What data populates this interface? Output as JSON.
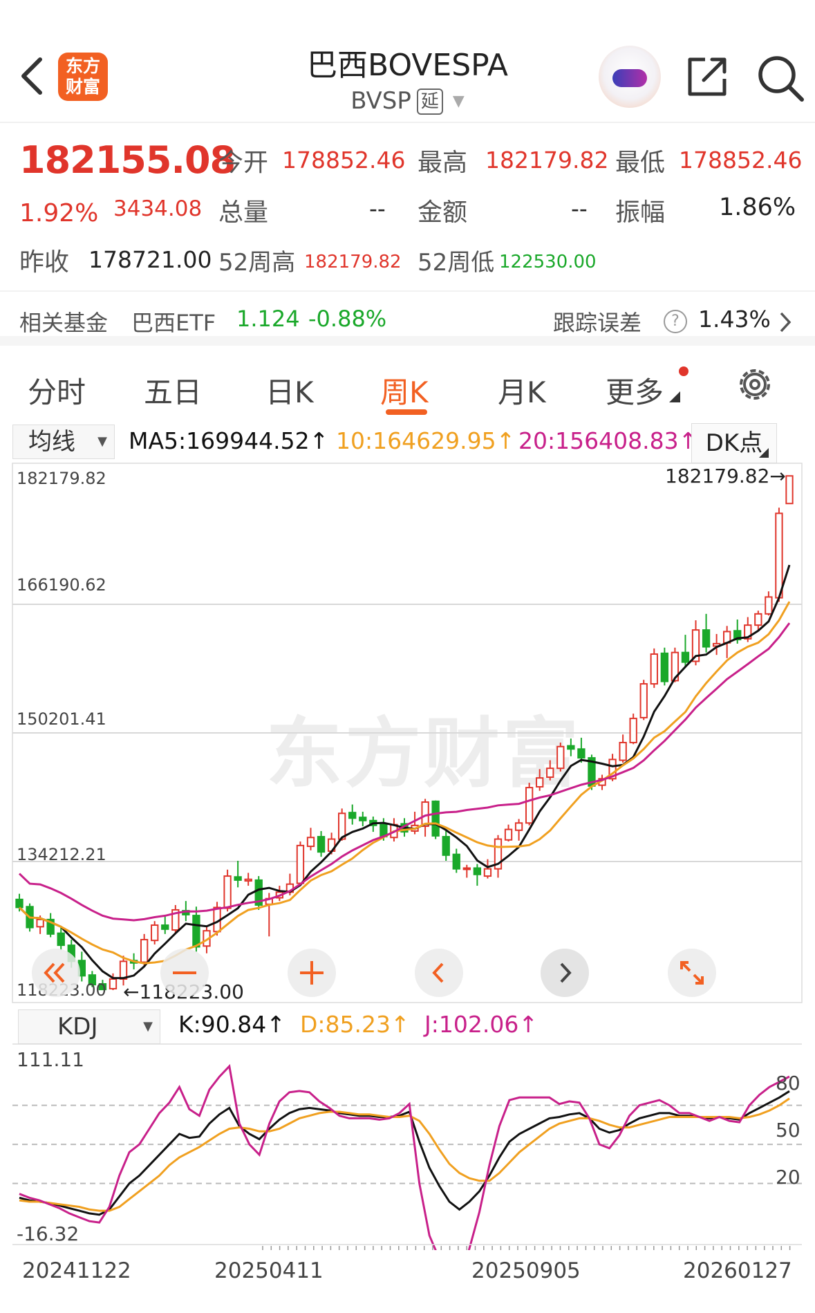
{
  "header": {
    "app_logo_line1": "东方",
    "app_logo_line2": "财富",
    "title": "巴西BOVESPA",
    "code": "BVSP",
    "delay_badge": "延"
  },
  "quote": {
    "last": "182155.08",
    "pct": "1.92%",
    "change": "3434.08",
    "open_label": "今开",
    "open": "178852.46",
    "high_label": "最高",
    "high": "182179.82",
    "low_label": "最低",
    "low": "178852.46",
    "vol_label": "总量",
    "vol": "--",
    "amount_label": "金额",
    "amount": "--",
    "amp_label": "振幅",
    "amp": "1.86%",
    "prev_label": "昨收",
    "prev": "178721.00",
    "w52h_label": "52周高",
    "w52h": "182179.82",
    "w52l_label": "52周低",
    "w52l": "122530.00"
  },
  "fund": {
    "label": "相关基金",
    "name": "巴西ETF",
    "price": "1.124",
    "pct": "-0.88%",
    "tracking_label": "跟踪误差",
    "tracking_help": "?",
    "tracking": "1.43%"
  },
  "tabs": [
    "分时",
    "五日",
    "日K",
    "周K",
    "月K",
    "更多"
  ],
  "ma": {
    "selector": "均线",
    "ma5": "MA5:169944.52↑",
    "ma10": "10:164629.95↑",
    "ma20": "20:156408.83↑",
    "dk": "DK点"
  },
  "kdj": {
    "selector": "KDJ",
    "k": "K:90.84↑",
    "d": "D:85.23↑",
    "j": "J:102.06↑"
  },
  "watermark": "东方财富",
  "colors": {
    "up": "#e0352b",
    "down": "#1aa82a",
    "ma5": "#111111",
    "ma10": "#f0a020",
    "ma20": "#c8208a",
    "accent": "#f26022"
  },
  "chart_data": [
    {
      "type": "candlestick",
      "title": "",
      "y_tick_labels": [
        "182179.82",
        "166190.62",
        "150201.41",
        "134212.21",
        "118223.00"
      ],
      "ylim": [
        118223.0,
        182179.82
      ],
      "max_marker": "182179.82→",
      "min_marker": "←118223.00",
      "x_tick_labels": [
        "20241122",
        "20250411",
        "20250905",
        "20260127"
      ],
      "candles": [
        [
          129500,
          128500,
          130200,
          128000
        ],
        [
          128600,
          126000,
          129000,
          125500
        ],
        [
          126100,
          127000,
          127500,
          125200
        ],
        [
          127000,
          125200,
          127800,
          124800
        ],
        [
          125300,
          123800,
          126000,
          123200
        ],
        [
          123800,
          121800,
          124500,
          121000
        ],
        [
          121900,
          120000,
          123000,
          119300
        ],
        [
          120100,
          118900,
          120600,
          118600
        ],
        [
          119000,
          118300,
          119500,
          118223
        ],
        [
          118400,
          119600,
          120300,
          118223
        ],
        [
          119600,
          121800,
          122500,
          118800
        ],
        [
          121900,
          121600,
          122800,
          120800
        ],
        [
          121700,
          124500,
          125200,
          121200
        ],
        [
          124400,
          126300,
          126800,
          123900
        ],
        [
          126300,
          125800,
          127500,
          125200
        ],
        [
          125700,
          128200,
          128800,
          125300
        ],
        [
          128100,
          127600,
          129300,
          126800
        ],
        [
          127500,
          123600,
          128600,
          123000
        ],
        [
          123700,
          125600,
          126200,
          122800
        ],
        [
          125500,
          128500,
          129200,
          125000
        ],
        [
          128400,
          132400,
          133200,
          128000
        ],
        [
          132300,
          131900,
          134300,
          131000
        ],
        [
          131800,
          132000,
          132800,
          131200
        ],
        [
          131900,
          128800,
          132400,
          128200
        ],
        [
          128900,
          129600,
          130300,
          124900
        ],
        [
          129700,
          130400,
          131200,
          129300
        ],
        [
          130400,
          131400,
          132700,
          130000
        ],
        [
          131500,
          136200,
          136700,
          131300
        ],
        [
          136100,
          137200,
          138400,
          135600
        ],
        [
          137300,
          135400,
          138000,
          134800
        ],
        [
          135500,
          137000,
          137800,
          135100
        ],
        [
          137000,
          140200,
          140800,
          136800
        ],
        [
          140300,
          139600,
          141300,
          138800
        ],
        [
          139700,
          139300,
          140400,
          138600
        ],
        [
          139300,
          138700,
          139800,
          137900
        ],
        [
          138800,
          137300,
          139600,
          136800
        ],
        [
          137200,
          138800,
          139600,
          136700
        ],
        [
          138900,
          137900,
          139600,
          137300
        ],
        [
          138000,
          138700,
          140400,
          137600
        ],
        [
          138600,
          141600,
          142000,
          137300
        ],
        [
          141700,
          137400,
          141800,
          137000
        ],
        [
          137300,
          135000,
          138000,
          134300
        ],
        [
          135100,
          133300,
          135800,
          132800
        ],
        [
          133300,
          133400,
          133800,
          132200
        ],
        [
          133400,
          132600,
          133900,
          131200
        ],
        [
          132400,
          133300,
          134500,
          132100
        ],
        [
          133300,
          137000,
          137500,
          132200
        ],
        [
          136900,
          138200,
          138800,
          136700
        ],
        [
          138100,
          139000,
          139500,
          136800
        ],
        [
          139000,
          143400,
          144000,
          138700
        ],
        [
          143500,
          144600,
          145700,
          143000
        ],
        [
          144700,
          145800,
          146800,
          144300
        ],
        [
          145800,
          148500,
          149000,
          145400
        ],
        [
          148600,
          148200,
          149500,
          147300
        ],
        [
          148200,
          147100,
          149600,
          146500
        ],
        [
          147100,
          143600,
          147500,
          143100
        ],
        [
          143700,
          144500,
          145000,
          143100
        ],
        [
          144500,
          146900,
          147600,
          144200
        ],
        [
          146800,
          149000,
          150000,
          146500
        ],
        [
          149000,
          152000,
          152600,
          148800
        ],
        [
          152100,
          156300,
          156800,
          151800
        ],
        [
          156300,
          160000,
          160700,
          155800
        ],
        [
          160100,
          156600,
          160800,
          156100
        ],
        [
          156700,
          160200,
          160800,
          156500
        ],
        [
          160200,
          159000,
          162400,
          158300
        ],
        [
          159100,
          163000,
          164200,
          158600
        ],
        [
          163000,
          160900,
          165000,
          160200
        ],
        [
          161000,
          161300,
          162500,
          159900
        ],
        [
          161400,
          162800,
          163500,
          159500
        ],
        [
          162900,
          161800,
          164300,
          161300
        ],
        [
          161900,
          163600,
          164600,
          161500
        ],
        [
          163600,
          165000,
          165400,
          162800
        ],
        [
          165000,
          167100,
          167800,
          164800
        ],
        [
          167000,
          177500,
          178200,
          166500
        ],
        [
          178721,
          182155.08,
          182179.82,
          178852.46
        ]
      ]
    },
    {
      "type": "line",
      "title": "",
      "y_tick_labels": [
        "111.11",
        "80",
        "50",
        "20",
        "-16.32"
      ],
      "ylim": [
        -16.32,
        111.11
      ],
      "reference_lines": [
        80,
        50,
        20
      ],
      "series": [
        {
          "name": "K",
          "values": [
            9,
            7,
            6,
            5,
            3,
            1,
            -1,
            -3,
            -4,
            0,
            10,
            20,
            26,
            34,
            42,
            50,
            58,
            55,
            56,
            66,
            73,
            78,
            64,
            58,
            54,
            62,
            69,
            74,
            77,
            78,
            77,
            76,
            74,
            73,
            72,
            72,
            71,
            71,
            72,
            75,
            52,
            32,
            18,
            6,
            0,
            6,
            14,
            26,
            40,
            52,
            58,
            62,
            66,
            70,
            71,
            73,
            74,
            70,
            62,
            59,
            61,
            66,
            70,
            72,
            74,
            74,
            72,
            72,
            71,
            70,
            71,
            70,
            69,
            74,
            78,
            82,
            86,
            90.84
          ]
        },
        {
          "name": "D",
          "values": [
            7,
            6,
            6,
            5,
            4,
            3,
            2,
            0,
            -1,
            -1,
            2,
            8,
            14,
            20,
            26,
            34,
            40,
            44,
            48,
            53,
            58,
            62,
            63,
            62,
            60,
            60,
            62,
            66,
            70,
            72,
            74,
            75,
            75,
            74,
            73,
            73,
            72,
            71,
            71,
            72,
            68,
            58,
            46,
            35,
            28,
            24,
            22,
            22,
            28,
            36,
            44,
            50,
            56,
            62,
            66,
            68,
            70,
            70,
            68,
            65,
            63,
            63,
            65,
            67,
            69,
            71,
            71,
            71,
            71,
            71,
            71,
            71,
            70,
            71,
            73,
            76,
            80,
            85.23
          ]
        },
        {
          "name": "J",
          "values": [
            12,
            9,
            7,
            4,
            1,
            -3,
            -6,
            -9,
            -10,
            2,
            26,
            44,
            50,
            62,
            74,
            82,
            94,
            77,
            72,
            92,
            102,
            110,
            66,
            50,
            42,
            66,
            83,
            90,
            91,
            90,
            83,
            78,
            72,
            70,
            70,
            70,
            69,
            70,
            74,
            81,
            20,
            -20,
            -38,
            -52,
            -58,
            -30,
            -2,
            34,
            64,
            84,
            86,
            86,
            86,
            86,
            81,
            83,
            82,
            70,
            50,
            47,
            57,
            72,
            80,
            82,
            84,
            80,
            74,
            74,
            71,
            68,
            71,
            68,
            67,
            80,
            88,
            94,
            98,
            102.06
          ]
        }
      ]
    }
  ]
}
